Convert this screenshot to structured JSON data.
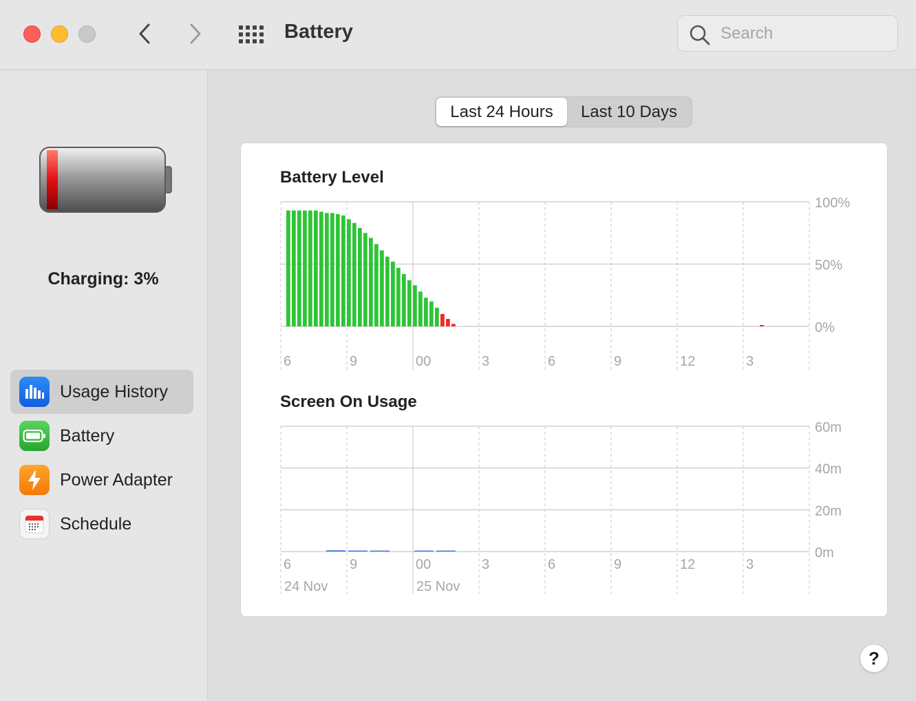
{
  "window": {
    "title": "Battery",
    "search_placeholder": "Search"
  },
  "sidebar": {
    "status_text": "Charging: 3%",
    "battery_level_fraction": 0.03,
    "items": [
      {
        "label": "Usage History",
        "icon": "usage-history-icon",
        "active": true
      },
      {
        "label": "Battery",
        "icon": "battery-icon",
        "active": false
      },
      {
        "label": "Power Adapter",
        "icon": "power-adapter-icon",
        "active": false
      },
      {
        "label": "Schedule",
        "icon": "schedule-icon",
        "active": false
      }
    ]
  },
  "range_tabs": [
    {
      "label": "Last 24 Hours",
      "selected": true
    },
    {
      "label": "Last 10 Days",
      "selected": false
    }
  ],
  "colors": {
    "battery_normal": "#2dc536",
    "battery_low": "#f12a25",
    "screen_usage": "#3f7ee0",
    "accent": "#1c6ff3"
  },
  "chart_data": [
    {
      "type": "bar",
      "title": "Battery Level",
      "x_tick_labels": [
        "6",
        "9",
        "00",
        "3",
        "6",
        "9",
        "12",
        "3"
      ],
      "y_tick_labels": [
        "100%",
        "50%",
        "0%"
      ],
      "ylim": [
        0,
        100
      ],
      "bar_slot_minutes": 15,
      "start_hour": 6,
      "values": [
        93,
        93,
        93,
        93,
        93,
        93,
        92,
        91,
        91,
        90,
        89,
        86,
        83,
        79,
        75,
        71,
        66,
        61,
        56,
        52,
        47,
        42,
        37,
        33,
        28,
        23,
        20,
        15,
        10,
        6,
        2
      ],
      "low_threshold": 10,
      "extra_points": [
        {
          "slot": 86,
          "value": 1
        }
      ]
    },
    {
      "type": "bar",
      "title": "Screen On Usage",
      "x_tick_labels": [
        "6",
        "9",
        "00",
        "3",
        "6",
        "9",
        "12",
        "3"
      ],
      "date_labels": [
        "24 Nov",
        "25 Nov"
      ],
      "y_tick_labels": [
        "60m",
        "40m",
        "20m",
        "0m"
      ],
      "ylim": [
        0,
        60
      ],
      "bar_slot_hours": 1,
      "start_hour": 6,
      "values": [
        0,
        0,
        0.6,
        0.3,
        0.3,
        0,
        0.3,
        0.3,
        0,
        0,
        0,
        0,
        0,
        0,
        0,
        0,
        0,
        0,
        0,
        0,
        0,
        0,
        0,
        0
      ]
    }
  ]
}
